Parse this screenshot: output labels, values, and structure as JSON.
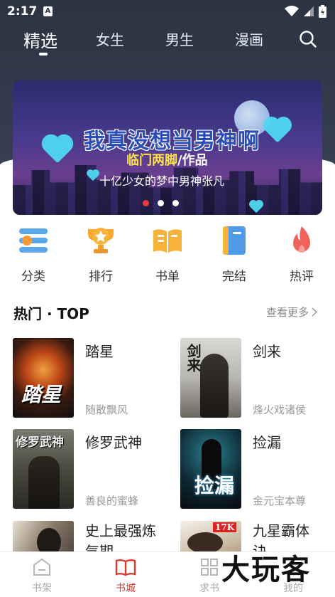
{
  "status": {
    "time": "2:17",
    "notif_icon": "A"
  },
  "topnav": {
    "tabs": [
      "精选",
      "女生",
      "男生",
      "漫画"
    ],
    "active": 0
  },
  "banner": {
    "title": "我真没想当男神啊",
    "author": "临门两脚",
    "author_suffix": "/作品",
    "tagline": "十亿少女的梦中男神张凡",
    "dots": 3,
    "active_dot": 0
  },
  "categories": [
    {
      "label": "分类",
      "icon": "category-icon"
    },
    {
      "label": "排行",
      "icon": "trophy-icon"
    },
    {
      "label": "书单",
      "icon": "book-list-icon"
    },
    {
      "label": "完结",
      "icon": "completed-book-icon"
    },
    {
      "label": "热评",
      "icon": "flame-icon"
    }
  ],
  "hot": {
    "title": "热门 · TOP",
    "more": "查看更多"
  },
  "books": [
    {
      "name": "踏星",
      "author": "随散飘风",
      "cover_text": "踏星"
    },
    {
      "name": "剑来",
      "author": "烽火戏诸侯",
      "cover_text": "剑来"
    },
    {
      "name": "修罗武神",
      "author": "善良的蜜蜂",
      "cover_text": "修罗武神"
    },
    {
      "name": "捡漏",
      "author": "金元宝本尊",
      "cover_text": "捡漏"
    },
    {
      "name": "史上最强炼气期",
      "author": "",
      "cover_text": ""
    },
    {
      "name": "九星霸体诀",
      "author": "",
      "cover_text": "17K"
    }
  ],
  "tabbar": [
    {
      "label": "书架",
      "icon": "bookshelf-icon"
    },
    {
      "label": "书城",
      "icon": "bookstore-icon"
    },
    {
      "label": "求书",
      "icon": "grid-icon"
    },
    {
      "label": "我的",
      "icon": "profile-icon"
    }
  ],
  "tabbar_active": 1,
  "watermark": "大玩客",
  "colors": {
    "accent": "#d93a30",
    "header_bg": "#323b4c"
  }
}
